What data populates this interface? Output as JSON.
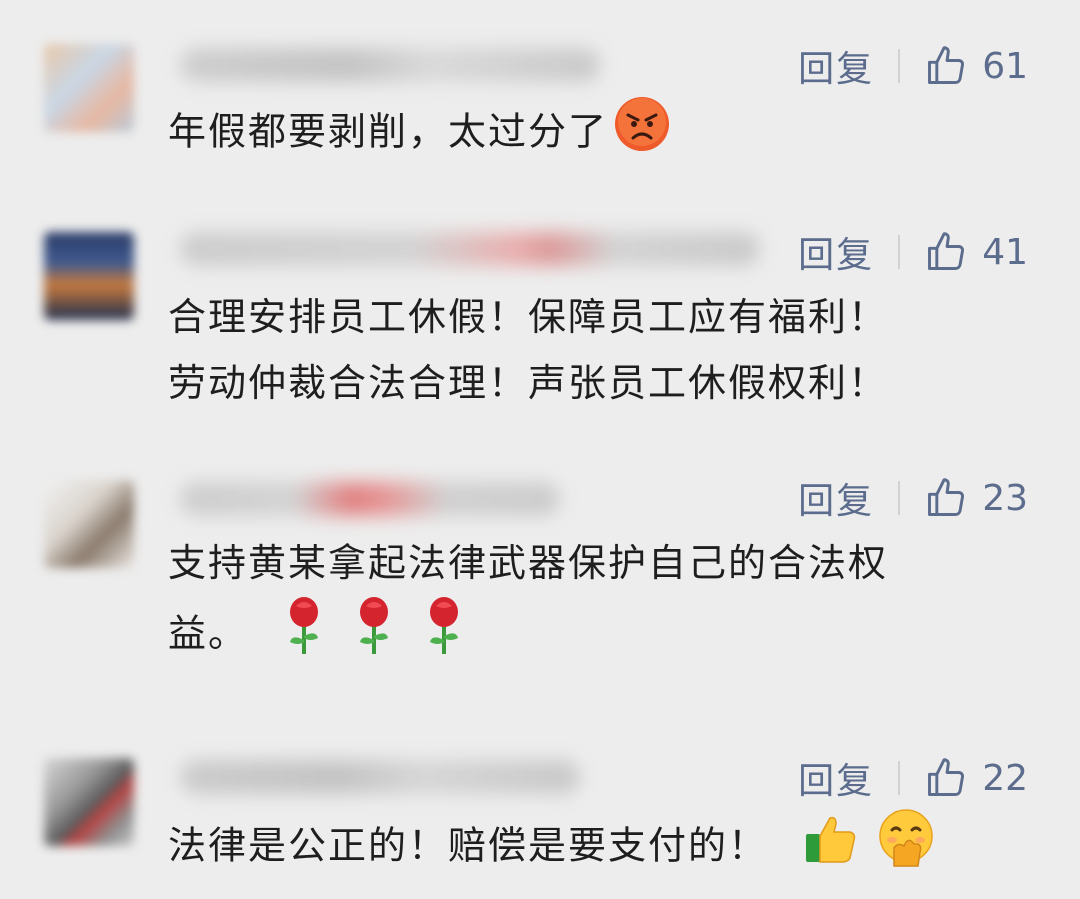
{
  "comments": [
    {
      "reply_label": "回复",
      "likes": "61",
      "text": "年假都要剥削，太过分了",
      "emoji": [
        "angry-face"
      ]
    },
    {
      "reply_label": "回复",
      "likes": "41",
      "line1": "合理安排员工休假！保障员工应有福利！",
      "line2": "劳动仲裁合法合理！声张员工休假权利！"
    },
    {
      "reply_label": "回复",
      "likes": "23",
      "line1": "支持黄某拿起法律武器保护自己的合法权",
      "line2": "益。",
      "emoji": [
        "rose",
        "rose",
        "rose"
      ]
    },
    {
      "reply_label": "回复",
      "likes": "22",
      "text": "法律是公正的！赔偿是要支付的！",
      "emoji": [
        "thumbs-up",
        "hand-over-mouth-face"
      ]
    }
  ],
  "colors": {
    "background": "#ededed",
    "action_text": "#5b6c8d",
    "comment_text": "#1e1e1e"
  }
}
